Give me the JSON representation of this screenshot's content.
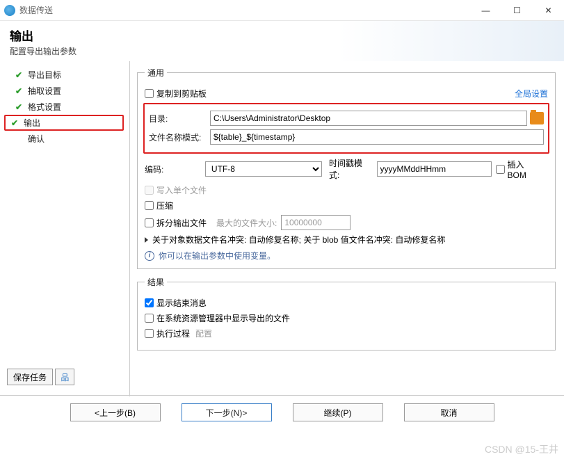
{
  "titlebar": {
    "title": "数据传送"
  },
  "header": {
    "title": "输出",
    "subtitle": "配置导出输出参数"
  },
  "sidebar": {
    "steps": [
      {
        "label": "导出目标"
      },
      {
        "label": "抽取设置"
      },
      {
        "label": "格式设置"
      },
      {
        "label": "输出"
      },
      {
        "label": "确认"
      }
    ]
  },
  "general": {
    "legend": "通用",
    "copy_clipboard": "复制到剪贴板",
    "global_link": "全局设置",
    "dir_label": "目录:",
    "dir_value": "C:\\Users\\Administrator\\Desktop",
    "pattern_label": "文件名称模式:",
    "pattern_value": "${table}_${timestamp}",
    "encoding_label": "编码:",
    "encoding_value": "UTF-8",
    "ts_label": "时间戳模式:",
    "ts_value": "yyyyMMddHHmm",
    "bom": "插入BOM",
    "single_file": "写入单个文件",
    "compress": "压缩",
    "split": "拆分输出文件",
    "split_hint": "最大的文件大小:",
    "split_value": "10000000",
    "conflict": "关于对象数据文件名冲突: 自动修复名称; 关于 blob 值文件名冲突: 自动修复名称",
    "info_text": "你可以在输出参数中使用变量。"
  },
  "result": {
    "legend": "结果",
    "show_end": "显示结束消息",
    "show_explorer": "在系统资源管理器中显示导出的文件",
    "exec": "执行过程",
    "config": "配置"
  },
  "bottom": {
    "save": "保存任务"
  },
  "wizard": {
    "back": "<上一步(B)",
    "next": "下一步(N)>",
    "continue": "继续(P)",
    "cancel": "取消"
  },
  "watermark": "CSDN @15-王井"
}
